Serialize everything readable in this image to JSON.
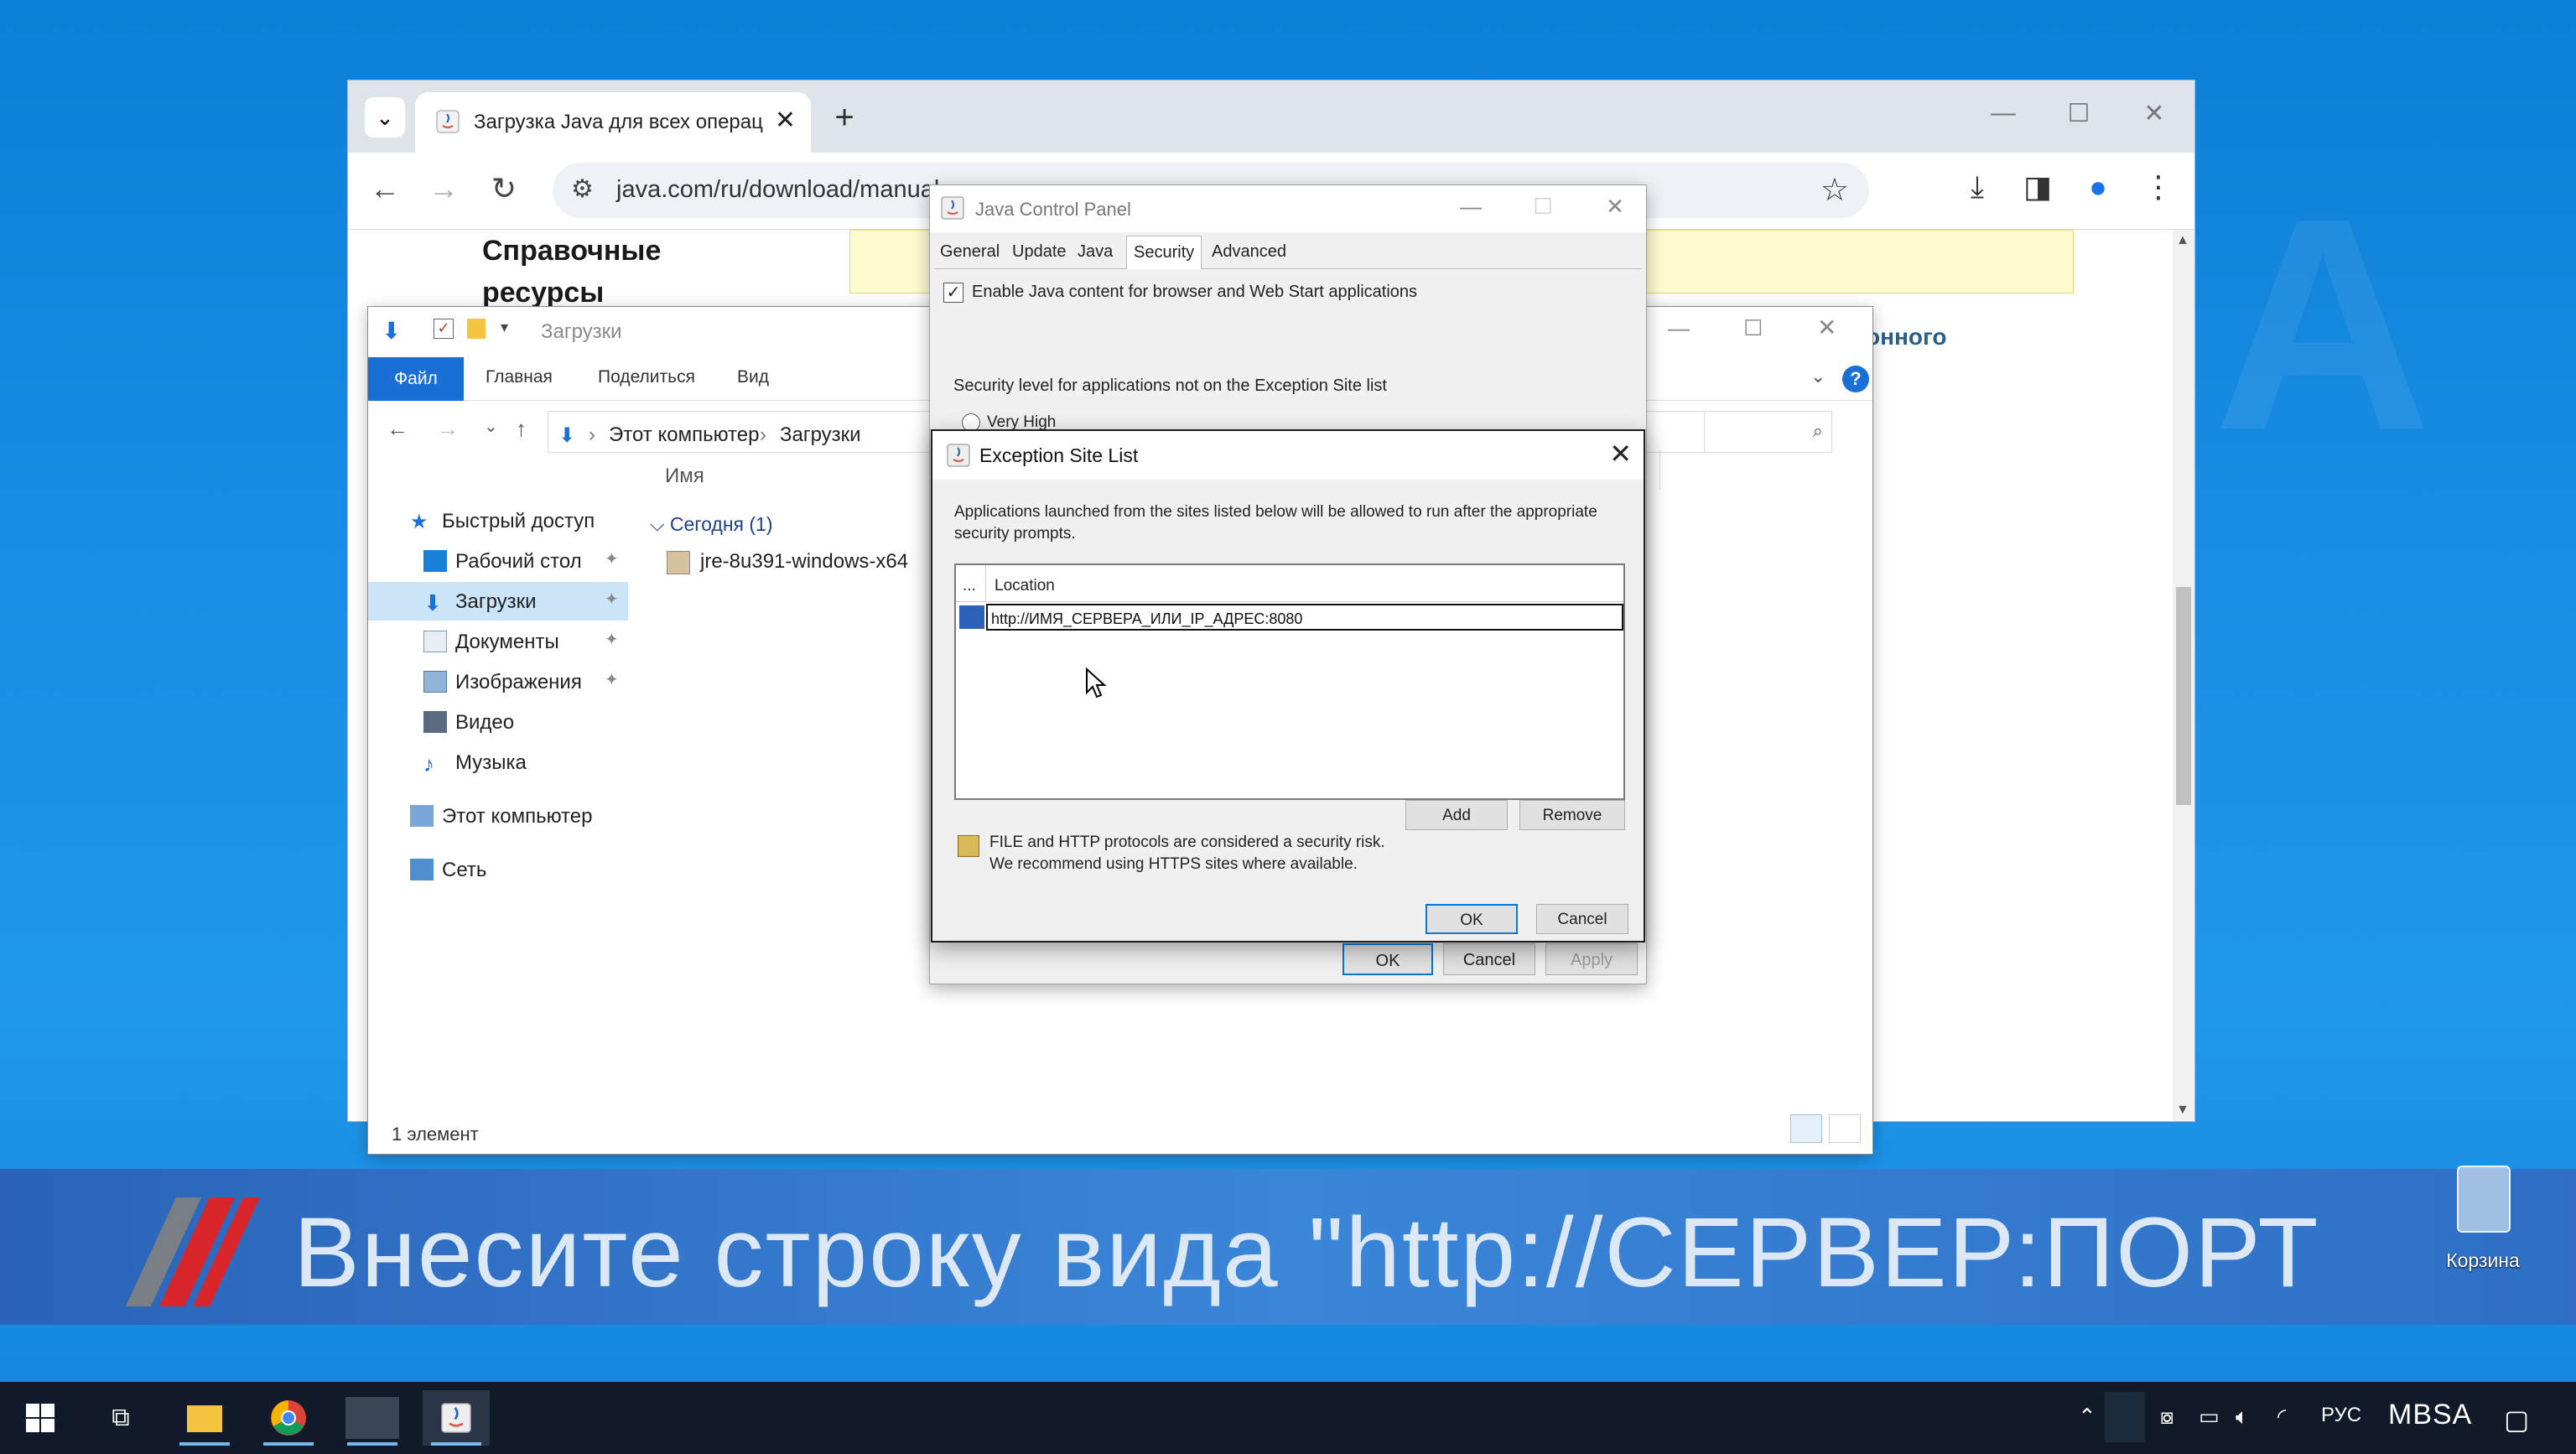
{
  "desktop": {
    "recycle_bin_label": "Корзина"
  },
  "chrome": {
    "tab_title": "Загрузка Java для всех операц",
    "url": "java.com/ru/download/manual",
    "page_heading": "Справочные ресурсы",
    "partial_link": "онного"
  },
  "explorer": {
    "title": "Загрузки",
    "ribbon_tabs": [
      "Файл",
      "Главная",
      "Поделиться",
      "Вид"
    ],
    "breadcrumb": [
      "Этот компьютер",
      "Загрузки"
    ],
    "nav": {
      "quick_access": "Быстрый доступ",
      "desktop": "Рабочий стол",
      "downloads": "Загрузки",
      "documents": "Документы",
      "images": "Изображения",
      "video": "Видео",
      "music": "Музыка",
      "this_pc": "Этот компьютер",
      "network": "Сеть"
    },
    "column_name": "Имя",
    "group_label": "Сегодня (1)",
    "file_name": "jre-8u391-windows-x64",
    "status": "1 элемент"
  },
  "java_control_panel": {
    "title": "Java Control Panel",
    "tabs": [
      "General",
      "Update",
      "Java",
      "Security",
      "Advanced"
    ],
    "active_tab": "Security",
    "enable_checkbox": "Enable Java content for browser and Web Start applications",
    "security_level_label": "Security level for applications not on the Exception Site list",
    "radio_very_high": "Very High",
    "ok": "OK",
    "cancel": "Cancel",
    "apply": "Apply"
  },
  "exception_site_list": {
    "title": "Exception Site List",
    "description": "Applications launched from the sites listed below will be allowed to run after the appropriate security prompts.",
    "col_ellipsis": "...",
    "col_location": "Location",
    "entry_value": "http://ИМЯ_СЕРВЕРА_ИЛИ_IP_АДРЕС:8080",
    "add": "Add",
    "remove": "Remove",
    "warning_line1": "FILE and HTTP protocols are considered a security risk.",
    "warning_line2": "We recommend using HTTPS sites where available.",
    "ok": "OK",
    "cancel": "Cancel"
  },
  "caption": {
    "text": "Внесите строку вида \"http://СЕРВЕР:ПОРТ"
  },
  "taskbar": {
    "language": "РУС",
    "user_label": "MBSA"
  },
  "colors": {
    "desktop_blue": "#1a8ee4",
    "banner_blue": "#3b86d9",
    "accent": "#0078d7",
    "taskbar": "#101a28"
  }
}
